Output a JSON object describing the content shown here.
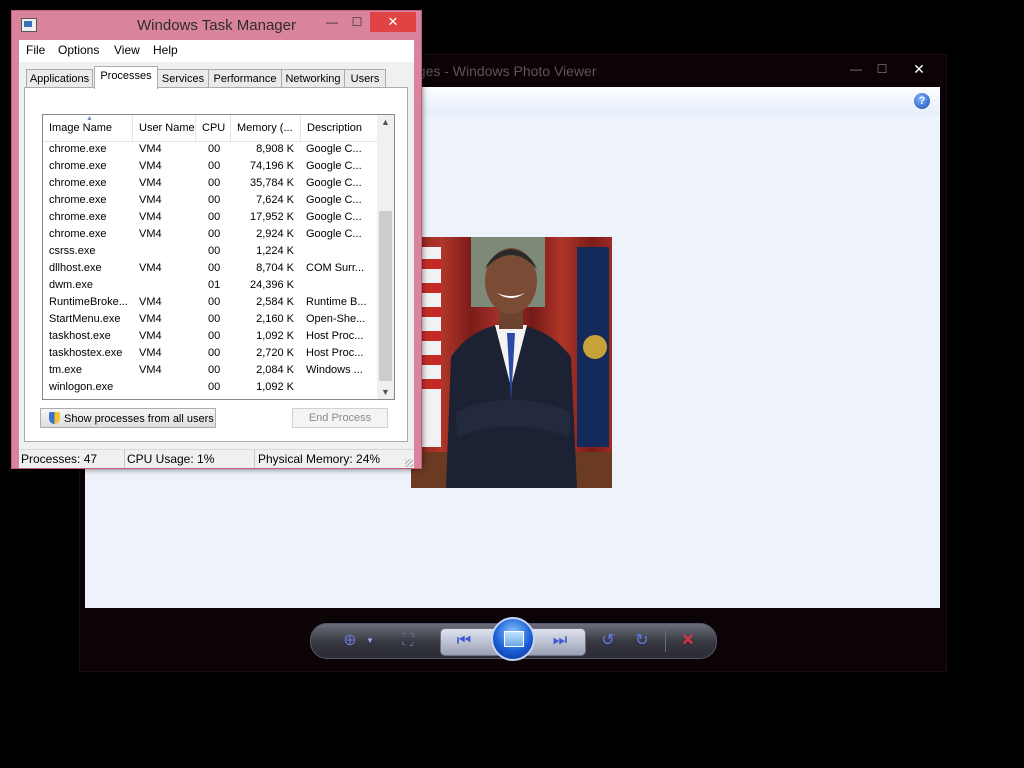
{
  "photo_viewer": {
    "title": "ages - Windows Photo Viewer",
    "min_glyph": "—",
    "max_glyph": "☐",
    "close_glyph": "✕",
    "help_glyph": "?",
    "controls": {
      "zoom_icon": "zoom-icon",
      "fit_icon": "actual-size-icon",
      "previous_icon": "previous-icon",
      "slideshow_icon": "slideshow-icon",
      "next_icon": "next-icon",
      "rotate_ccw_icon": "rotate-counterclockwise-icon",
      "rotate_cw_icon": "rotate-clockwise-icon",
      "delete_icon": "delete-icon"
    }
  },
  "task_manager": {
    "title": "Windows Task Manager",
    "close_glyph": "✕",
    "menu": [
      "File",
      "Options",
      "View",
      "Help"
    ],
    "tabs": [
      "Applications",
      "Processes",
      "Services",
      "Performance",
      "Networking",
      "Users"
    ],
    "active_tab": "Processes",
    "columns": [
      "Image Name",
      "User Name",
      "CPU",
      "Memory (...",
      "Description"
    ],
    "processes": [
      {
        "name": "chrome.exe",
        "user": "VM4",
        "cpu": "00",
        "mem": "8,908 K",
        "desc": "Google C..."
      },
      {
        "name": "chrome.exe",
        "user": "VM4",
        "cpu": "00",
        "mem": "74,196 K",
        "desc": "Google C..."
      },
      {
        "name": "chrome.exe",
        "user": "VM4",
        "cpu": "00",
        "mem": "35,784 K",
        "desc": "Google C..."
      },
      {
        "name": "chrome.exe",
        "user": "VM4",
        "cpu": "00",
        "mem": "7,624 K",
        "desc": "Google C..."
      },
      {
        "name": "chrome.exe",
        "user": "VM4",
        "cpu": "00",
        "mem": "17,952 K",
        "desc": "Google C..."
      },
      {
        "name": "chrome.exe",
        "user": "VM4",
        "cpu": "00",
        "mem": "2,924 K",
        "desc": "Google C..."
      },
      {
        "name": "csrss.exe",
        "user": "",
        "cpu": "00",
        "mem": "1,224 K",
        "desc": ""
      },
      {
        "name": "dllhost.exe",
        "user": "VM4",
        "cpu": "00",
        "mem": "8,704 K",
        "desc": "COM Surr..."
      },
      {
        "name": "dwm.exe",
        "user": "",
        "cpu": "01",
        "mem": "24,396 K",
        "desc": ""
      },
      {
        "name": "RuntimeBroke...",
        "user": "VM4",
        "cpu": "00",
        "mem": "2,584 K",
        "desc": "Runtime B..."
      },
      {
        "name": "StartMenu.exe",
        "user": "VM4",
        "cpu": "00",
        "mem": "2,160 K",
        "desc": "Open-She..."
      },
      {
        "name": "taskhost.exe",
        "user": "VM4",
        "cpu": "00",
        "mem": "1,092 K",
        "desc": "Host Proc..."
      },
      {
        "name": "taskhostex.exe",
        "user": "VM4",
        "cpu": "00",
        "mem": "2,720 K",
        "desc": "Host Proc..."
      },
      {
        "name": "tm.exe",
        "user": "VM4",
        "cpu": "00",
        "mem": "2,084 K",
        "desc": "Windows ..."
      },
      {
        "name": "winlogon.exe",
        "user": "",
        "cpu": "00",
        "mem": "1,092 K",
        "desc": ""
      }
    ],
    "show_all_button": "Show processes from all users",
    "end_process_button": "End Process",
    "status": {
      "processes": "Processes: 47",
      "cpu": "CPU Usage: 1%",
      "memory": "Physical Memory: 24%"
    }
  }
}
